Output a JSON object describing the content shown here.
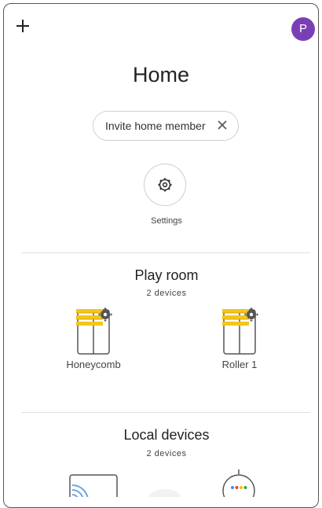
{
  "header": {
    "add_icon": "plus-icon",
    "avatar_letter": "P",
    "avatar_color": "#7b3fb5"
  },
  "page": {
    "title": "Home"
  },
  "invite": {
    "label": "Invite home member",
    "close_icon": "close-icon"
  },
  "settings": {
    "label": "Settings",
    "icon": "gear-icon"
  },
  "rooms": [
    {
      "name": "Play room",
      "count": "2 devices",
      "devices": [
        {
          "name": "Honeycomb",
          "icon": "window-blind-icon"
        },
        {
          "name": "Roller 1",
          "icon": "window-blind-icon"
        }
      ]
    }
  ],
  "local": {
    "title": "Local devices",
    "count": "2 devices",
    "devices": [
      {
        "icon": "cast-device-icon"
      },
      {
        "icon": "device-icon"
      },
      {
        "icon": "smart-speaker-icon"
      }
    ]
  },
  "colors": {
    "blind_yellow": "#f5c518",
    "speaker_dots": [
      "#4285f4",
      "#ea4335",
      "#fbbc05",
      "#34a853"
    ]
  }
}
